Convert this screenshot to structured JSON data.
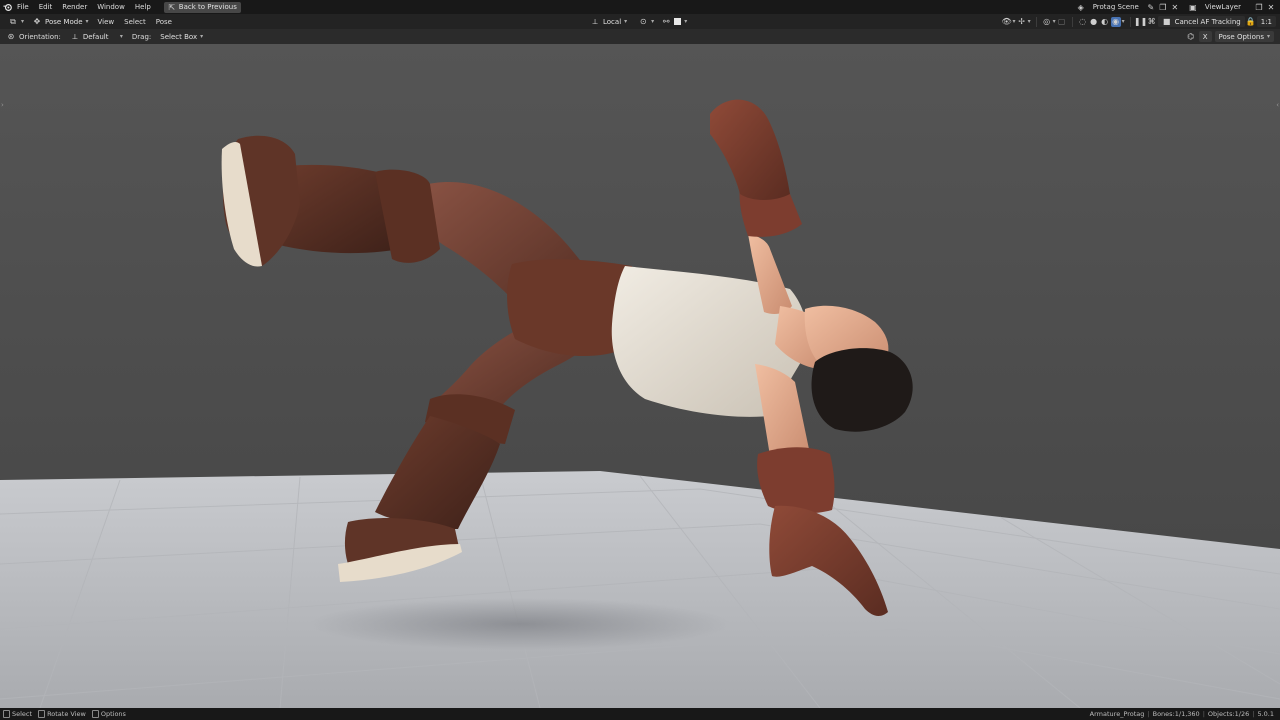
{
  "topbar": {
    "menus": [
      "File",
      "Edit",
      "Render",
      "Window",
      "Help"
    ],
    "back_button": "Back to Previous",
    "scene_name": "Protag Scene",
    "view_layer": "ViewLayer"
  },
  "header": {
    "mode": "Pose Mode",
    "menus": [
      "View",
      "Select",
      "Pose"
    ],
    "transform_space": "Local",
    "cancel_af": "Cancel AF Tracking",
    "ratio": "1:1"
  },
  "tool_settings": {
    "orientation_label": "Orientation:",
    "orientation_value": "Default",
    "drag_label": "Drag:",
    "drag_value": "Select Box",
    "pose_options": "Pose Options",
    "x_label": "X"
  },
  "statusbar": {
    "select": "Select",
    "rotate_view": "Rotate View",
    "options": "Options",
    "armature": "Armature_Protag",
    "bones": "Bones:1/1,360",
    "objects": "Objects:1/26",
    "version": "5.0.1"
  },
  "colors": {
    "viewport_bg": "#4a4a4a",
    "floor": "#bfc1c5",
    "leather": "#5a3226",
    "shirt": "#e6e0d6",
    "skin": "#e0a98c",
    "glove": "#7a3d2e"
  }
}
